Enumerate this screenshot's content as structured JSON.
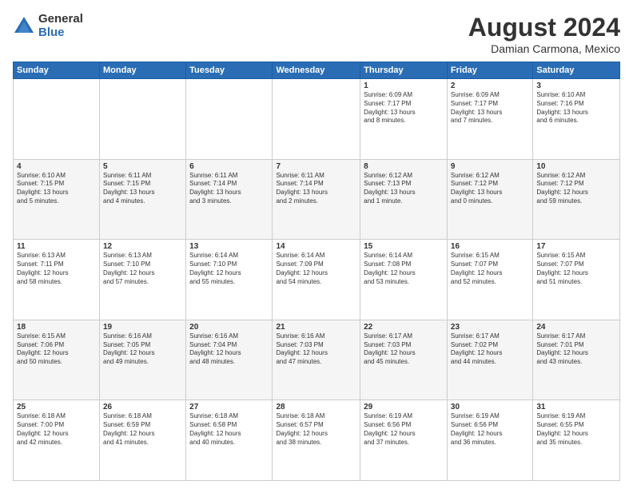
{
  "logo": {
    "general": "General",
    "blue": "Blue"
  },
  "title": "August 2024",
  "subtitle": "Damian Carmona, Mexico",
  "days_of_week": [
    "Sunday",
    "Monday",
    "Tuesday",
    "Wednesday",
    "Thursday",
    "Friday",
    "Saturday"
  ],
  "weeks": [
    [
      {
        "day": "",
        "content": ""
      },
      {
        "day": "",
        "content": ""
      },
      {
        "day": "",
        "content": ""
      },
      {
        "day": "",
        "content": ""
      },
      {
        "day": "1",
        "content": "Sunrise: 6:09 AM\nSunset: 7:17 PM\nDaylight: 13 hours\nand 8 minutes."
      },
      {
        "day": "2",
        "content": "Sunrise: 6:09 AM\nSunset: 7:17 PM\nDaylight: 13 hours\nand 7 minutes."
      },
      {
        "day": "3",
        "content": "Sunrise: 6:10 AM\nSunset: 7:16 PM\nDaylight: 13 hours\nand 6 minutes."
      }
    ],
    [
      {
        "day": "4",
        "content": "Sunrise: 6:10 AM\nSunset: 7:15 PM\nDaylight: 13 hours\nand 5 minutes."
      },
      {
        "day": "5",
        "content": "Sunrise: 6:11 AM\nSunset: 7:15 PM\nDaylight: 13 hours\nand 4 minutes."
      },
      {
        "day": "6",
        "content": "Sunrise: 6:11 AM\nSunset: 7:14 PM\nDaylight: 13 hours\nand 3 minutes."
      },
      {
        "day": "7",
        "content": "Sunrise: 6:11 AM\nSunset: 7:14 PM\nDaylight: 13 hours\nand 2 minutes."
      },
      {
        "day": "8",
        "content": "Sunrise: 6:12 AM\nSunset: 7:13 PM\nDaylight: 13 hours\nand 1 minute."
      },
      {
        "day": "9",
        "content": "Sunrise: 6:12 AM\nSunset: 7:12 PM\nDaylight: 13 hours\nand 0 minutes."
      },
      {
        "day": "10",
        "content": "Sunrise: 6:12 AM\nSunset: 7:12 PM\nDaylight: 12 hours\nand 59 minutes."
      }
    ],
    [
      {
        "day": "11",
        "content": "Sunrise: 6:13 AM\nSunset: 7:11 PM\nDaylight: 12 hours\nand 58 minutes."
      },
      {
        "day": "12",
        "content": "Sunrise: 6:13 AM\nSunset: 7:10 PM\nDaylight: 12 hours\nand 57 minutes."
      },
      {
        "day": "13",
        "content": "Sunrise: 6:14 AM\nSunset: 7:10 PM\nDaylight: 12 hours\nand 55 minutes."
      },
      {
        "day": "14",
        "content": "Sunrise: 6:14 AM\nSunset: 7:09 PM\nDaylight: 12 hours\nand 54 minutes."
      },
      {
        "day": "15",
        "content": "Sunrise: 6:14 AM\nSunset: 7:08 PM\nDaylight: 12 hours\nand 53 minutes."
      },
      {
        "day": "16",
        "content": "Sunrise: 6:15 AM\nSunset: 7:07 PM\nDaylight: 12 hours\nand 52 minutes."
      },
      {
        "day": "17",
        "content": "Sunrise: 6:15 AM\nSunset: 7:07 PM\nDaylight: 12 hours\nand 51 minutes."
      }
    ],
    [
      {
        "day": "18",
        "content": "Sunrise: 6:15 AM\nSunset: 7:06 PM\nDaylight: 12 hours\nand 50 minutes."
      },
      {
        "day": "19",
        "content": "Sunrise: 6:16 AM\nSunset: 7:05 PM\nDaylight: 12 hours\nand 49 minutes."
      },
      {
        "day": "20",
        "content": "Sunrise: 6:16 AM\nSunset: 7:04 PM\nDaylight: 12 hours\nand 48 minutes."
      },
      {
        "day": "21",
        "content": "Sunrise: 6:16 AM\nSunset: 7:03 PM\nDaylight: 12 hours\nand 47 minutes."
      },
      {
        "day": "22",
        "content": "Sunrise: 6:17 AM\nSunset: 7:03 PM\nDaylight: 12 hours\nand 45 minutes."
      },
      {
        "day": "23",
        "content": "Sunrise: 6:17 AM\nSunset: 7:02 PM\nDaylight: 12 hours\nand 44 minutes."
      },
      {
        "day": "24",
        "content": "Sunrise: 6:17 AM\nSunset: 7:01 PM\nDaylight: 12 hours\nand 43 minutes."
      }
    ],
    [
      {
        "day": "25",
        "content": "Sunrise: 6:18 AM\nSunset: 7:00 PM\nDaylight: 12 hours\nand 42 minutes."
      },
      {
        "day": "26",
        "content": "Sunrise: 6:18 AM\nSunset: 6:59 PM\nDaylight: 12 hours\nand 41 minutes."
      },
      {
        "day": "27",
        "content": "Sunrise: 6:18 AM\nSunset: 6:58 PM\nDaylight: 12 hours\nand 40 minutes."
      },
      {
        "day": "28",
        "content": "Sunrise: 6:18 AM\nSunset: 6:57 PM\nDaylight: 12 hours\nand 38 minutes."
      },
      {
        "day": "29",
        "content": "Sunrise: 6:19 AM\nSunset: 6:56 PM\nDaylight: 12 hours\nand 37 minutes."
      },
      {
        "day": "30",
        "content": "Sunrise: 6:19 AM\nSunset: 6:56 PM\nDaylight: 12 hours\nand 36 minutes."
      },
      {
        "day": "31",
        "content": "Sunrise: 6:19 AM\nSunset: 6:55 PM\nDaylight: 12 hours\nand 35 minutes."
      }
    ]
  ]
}
